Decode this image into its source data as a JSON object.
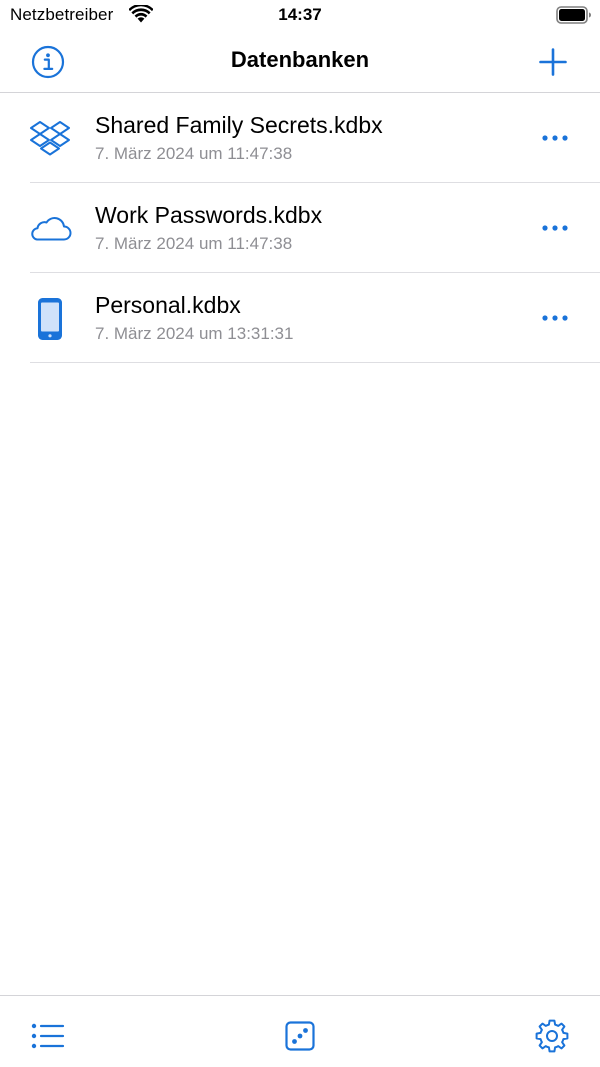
{
  "status_bar": {
    "carrier": "Netzbetreiber",
    "time": "14:37",
    "icons": [
      "wifi-icon",
      "battery-icon"
    ]
  },
  "nav": {
    "title": "Datenbanken",
    "left_icon": "info-icon",
    "right_icon": "plus-icon"
  },
  "databases": [
    {
      "name": "Shared Family Secrets.kdbx",
      "date": "7. März 2024 um 11:47:38",
      "icon": "dropbox-icon"
    },
    {
      "name": "Work Passwords.kdbx",
      "date": "7. März 2024 um 11:47:38",
      "icon": "cloud-icon"
    },
    {
      "name": "Personal.kdbx",
      "date": "7. März 2024 um 13:31:31",
      "icon": "phone-icon"
    }
  ],
  "tab_bar": {
    "icons": [
      "list-icon",
      "dice-icon",
      "gear-icon"
    ]
  },
  "colors": {
    "accent": "#1a73d9",
    "secondary_text": "#8e8e93",
    "separator": "#dedee2"
  }
}
